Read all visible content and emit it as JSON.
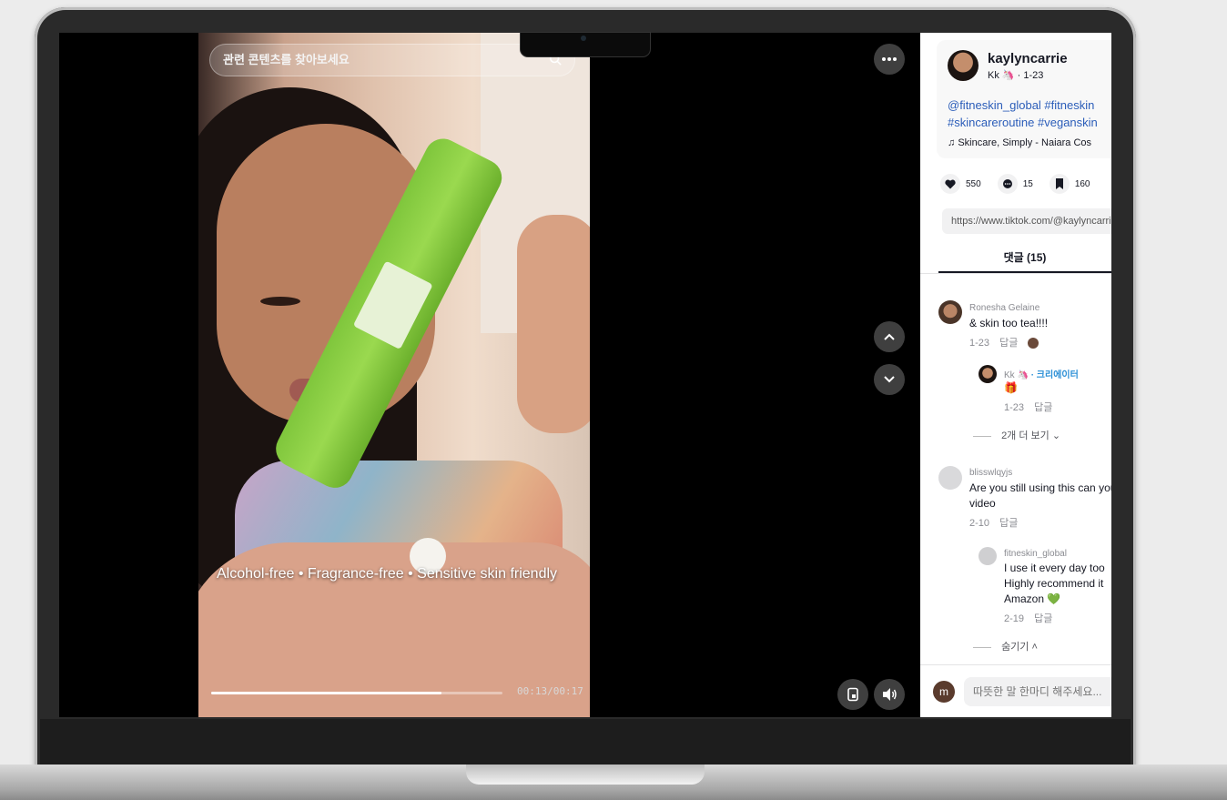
{
  "video": {
    "search_placeholder": "관련 콘텐츠를 찾아보세요",
    "caption": "Alcohol-free • Fragrance-free • Sensitive skin friendly",
    "time": "00:13/00:17",
    "progress": 0.79
  },
  "author": {
    "username": "kaylyncarrie",
    "nickname_date": "Kk 🦄 · 1-23",
    "hashtags_line1": "@fitneskin_global #fitneskin",
    "hashtags_line2": "#skincareroutine #veganskin",
    "music_icon": "music-note-icon",
    "music": "Skincare, Simply - Naiara Cos"
  },
  "stats": {
    "likes": "550",
    "comments": "15",
    "saves": "160"
  },
  "share_url": "https://www.tiktok.com/@kaylyncarrie",
  "tabs": {
    "comments": "댓글 (15)"
  },
  "comments": [
    {
      "name": "Ronesha Gelaine",
      "text": "& skin too tea!!!!",
      "date": "1-23",
      "reply": "답글"
    },
    {
      "name": "Kk 🦄",
      "creator_label": "· 크리에이터",
      "text": "🎁",
      "date": "1-23",
      "reply": "답글"
    },
    {
      "name": "blisswlqyjs",
      "text_line1": "Are you still using this can you",
      "text_line2": "video",
      "date": "2-10",
      "reply": "답글"
    },
    {
      "name": "fitneskin_global",
      "text_line1": "I use it every day too",
      "text_line2": "Highly recommend it",
      "text_line3": "Amazon 💚",
      "date": "2-19",
      "reply": "답글"
    }
  ],
  "view_more": "2개 더 보기",
  "hide": "숨기기",
  "input": {
    "avatar_letter": "m",
    "placeholder": "따뜻한 말 한마디 해주세요..."
  }
}
